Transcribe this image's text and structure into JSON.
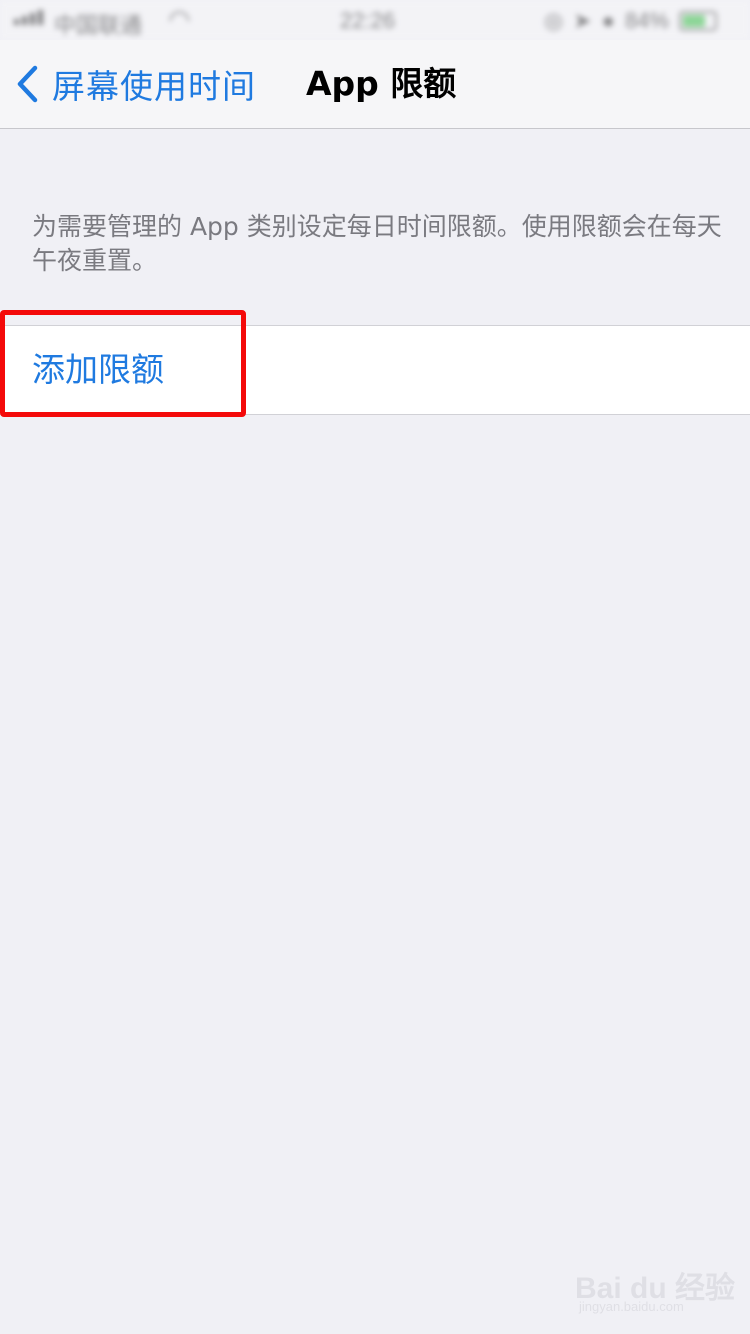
{
  "status_bar": {
    "carrier": "中国联通",
    "time": "22:26",
    "battery": "84%"
  },
  "nav": {
    "back_label": "屏幕使用时间",
    "title": "App 限额"
  },
  "description": "为需要管理的 App 类别设定每日时间限额。使用限额会在每天午夜重置。",
  "list": {
    "add_limit_label": "添加限额"
  },
  "watermark": {
    "brand": "Bai du 经验",
    "url": "jingyan.baidu.com"
  },
  "colors": {
    "accent": "#1f7ae0",
    "background": "#f0f0f5",
    "highlight": "#f40a0a"
  }
}
